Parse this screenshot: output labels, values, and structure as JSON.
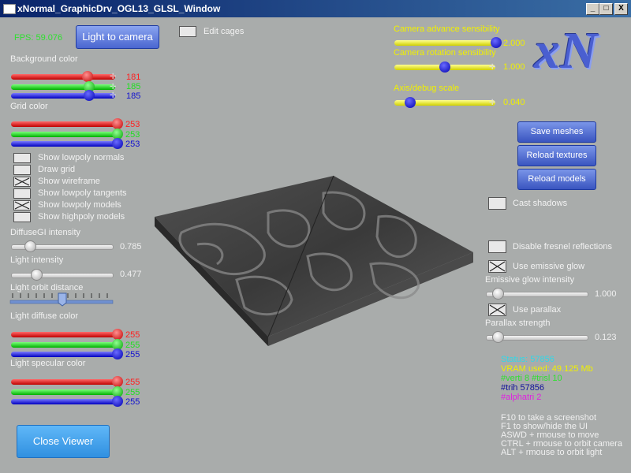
{
  "window": {
    "title": "xNormal_GraphicDrv_OGL13_GLSL_Window",
    "min": "_",
    "max": "□",
    "close": "X"
  },
  "fps": "FPS: 59.076",
  "buttons": {
    "light_to_camera": "Light to camera",
    "save_meshes": "Save meshes",
    "reload_textures": "Reload textures",
    "reload_models": "Reload models",
    "close_viewer": "Close Viewer"
  },
  "edit_cages": "Edit cages",
  "background_color": {
    "label": "Background color",
    "r": "181",
    "g": "185",
    "b": "185"
  },
  "grid_color": {
    "label": "Grid color",
    "r": "253",
    "g": "253",
    "b": "253"
  },
  "checkboxes": [
    {
      "label": "Show lowpoly normals",
      "checked": false
    },
    {
      "label": "Draw grid",
      "checked": false
    },
    {
      "label": "Show wireframe",
      "checked": true
    },
    {
      "label": "Show lowpoly tangents",
      "checked": false
    },
    {
      "label": "Show lowpoly models",
      "checked": true
    },
    {
      "label": "Show highpoly models",
      "checked": false
    }
  ],
  "diffuse_gi": {
    "label": "DiffuseGI intensity",
    "value": "0.785"
  },
  "light_intensity": {
    "label": "Light intensity",
    "value": "0.477"
  },
  "light_orbit": {
    "label": "Light orbit distance"
  },
  "light_diffuse": {
    "label": "Light diffuse color",
    "r": "255",
    "g": "255",
    "b": "255"
  },
  "light_specular": {
    "label": "Light specular color",
    "r": "255",
    "g": "255",
    "b": "255"
  },
  "camera_advance": {
    "label": "Camera advance sensibility",
    "value": "2.000"
  },
  "camera_rotation": {
    "label": "Camera rotation sensibility",
    "value": "1.000"
  },
  "axis_debug": {
    "label": "Axis/debug scale",
    "value": "0.040"
  },
  "logo": "xN",
  "cast_shadows": "Cast shadows",
  "disable_fresnel": "Disable fresnel reflections",
  "use_emissive": "Use emissive glow",
  "emissive_intensity": {
    "label": "Emissive glow intensity",
    "value": "1.000"
  },
  "use_parallax": "Use parallax",
  "parallax_strength": {
    "label": "Parallax strength",
    "value": "0.123"
  },
  "stats": {
    "status": "Status: 57856",
    "vram": "VRAM used: 49.125 Mb",
    "verts": "#verti 8 #trisl 10",
    "trih": "#trih 57856",
    "alphatri": "#alphatri 2"
  },
  "help": [
    "F10 to take a screenshot",
    "F1 to show/hide the UI",
    "ASWD + rmouse to move",
    "CTRL + rmouse to orbit camera",
    "ALT + rmouse to orbit light"
  ],
  "colors": {
    "title_bar": "#0a246a",
    "background": "#a9acab",
    "button": "#4a66d0",
    "close_viewer": "#3fa0e8",
    "yellow_label": "#f0f000"
  }
}
